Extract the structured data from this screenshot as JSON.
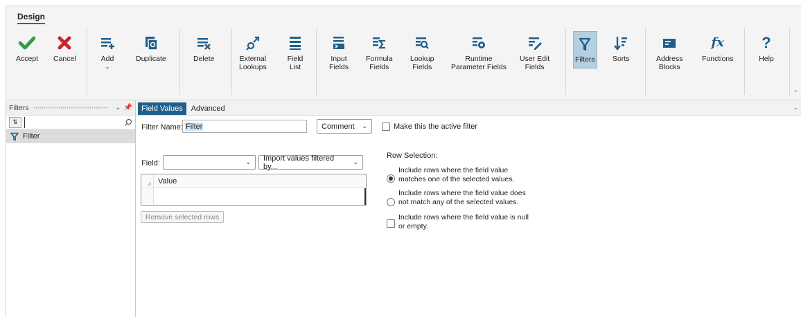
{
  "ribbon": {
    "tab": "Design",
    "buttons": {
      "accept": "Accept",
      "cancel": "Cancel",
      "add": "Add",
      "duplicate": "Duplicate",
      "delete": "Delete",
      "external_lookups": "External\nLookups",
      "field_list": "Field\nList",
      "input_fields": "Input\nFields",
      "formula_fields": "Formula\nFields",
      "lookup_fields": "Lookup\nFields",
      "runtime_parameter_fields": "Runtime\nParameter Fields",
      "user_edit_fields": "User Edit\nFields",
      "filters": "Filters",
      "sorts": "Sorts",
      "address_blocks": "Address\nBlocks",
      "functions": "Functions",
      "help": "Help"
    },
    "colors": {
      "accent": "#1f5f8b",
      "accept": "#2ea043",
      "cancel": "#c62828",
      "icon": "#1f5f8b",
      "active": "#b4cfe0"
    }
  },
  "filters_pane": {
    "title": "Filters",
    "search_value": "",
    "items": [
      {
        "label": "Filter"
      }
    ]
  },
  "editor": {
    "tabs": [
      {
        "label": "Field Values"
      },
      {
        "label": "Advanced"
      }
    ],
    "filter_name_label": "Filter Name:",
    "filter_name_value": "Filter",
    "comment_button": "Comment",
    "active_filter_label": "Make this the active filter",
    "field_label": "Field:",
    "field_value": "",
    "import_button": "Import values filtered by...",
    "grid": {
      "column": "Value"
    },
    "remove_button": "Remove selected rows",
    "row_selection": {
      "title": "Row Selection:",
      "option_match": "Include rows where the field value\nmatches one of the selected values.",
      "option_not_match": "Include rows where the field value does\nnot match any of the selected values.",
      "option_null": "Include rows where the field value is null\nor empty."
    }
  }
}
